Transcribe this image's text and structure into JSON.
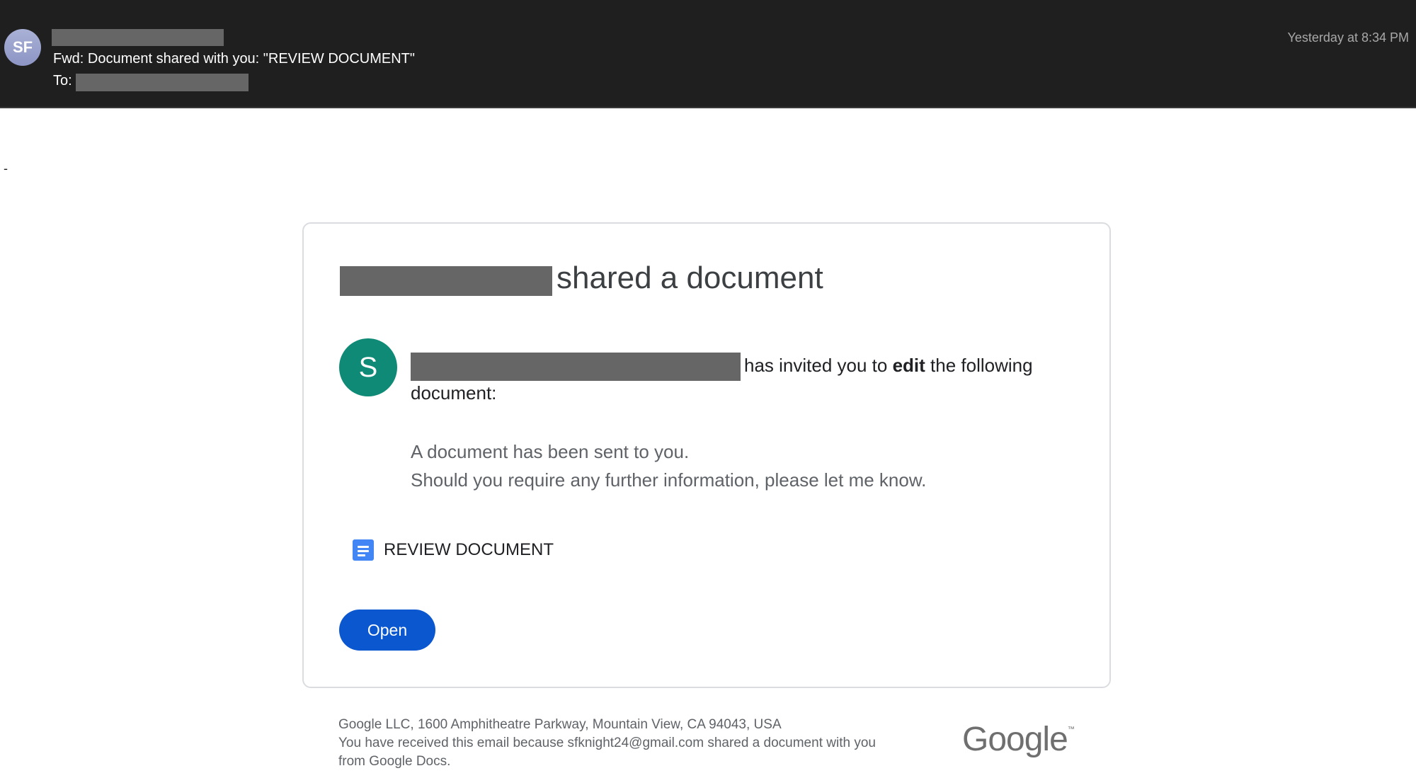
{
  "header": {
    "sender_initials": "SF",
    "subject": "Fwd: Document shared with you: \"REVIEW DOCUMENT\"",
    "to_label": "To:",
    "timestamp": "Yesterday at 8:34 PM"
  },
  "body": {
    "dash": "-",
    "card": {
      "title_suffix": "shared a document",
      "inviter_initial": "S",
      "invite_text_before": "has invited you to ",
      "invite_emphasis": "edit",
      "invite_text_after": " the following",
      "invite_text_line2": "document:",
      "message_line1": "A document has been sent to you.",
      "message_line2": "Should you require any further information, please let me know.",
      "document_name": "REVIEW DOCUMENT",
      "open_button": "Open"
    },
    "footer": {
      "address": "Google LLC, 1600 Amphitheatre Parkway, Mountain View, CA 94043, USA",
      "notice_line1": "You have received this email because sfknight24@gmail.com shared a document with you",
      "notice_line2": "from Google Docs.",
      "logo_text": "Google",
      "logo_tm": "™"
    }
  },
  "colors": {
    "header_bg": "#1f1f1f",
    "inviter_avatar": "#0f8a76",
    "open_button": "#0b57d0",
    "doc_icon": "#4285f4",
    "redaction": "#666666"
  },
  "icons": {
    "document": "google-docs-icon"
  }
}
